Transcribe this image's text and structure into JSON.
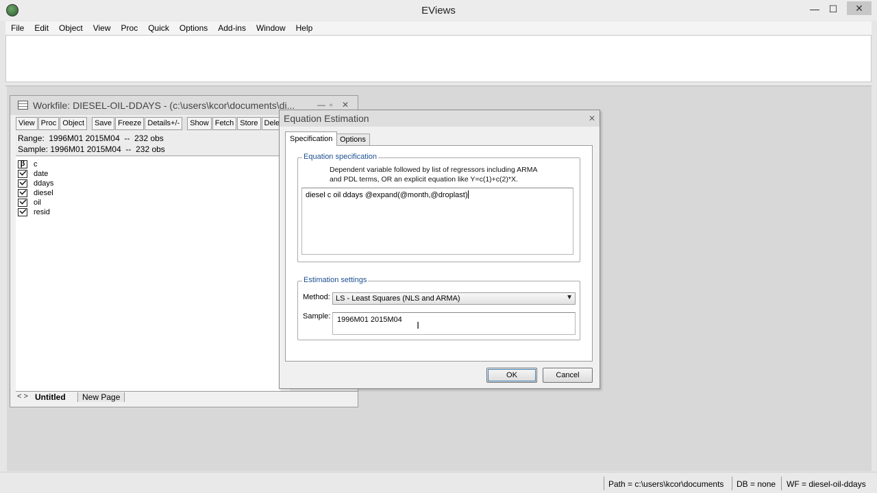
{
  "window": {
    "title": "EViews",
    "minimize": "—",
    "maximize": "☐",
    "close": "✕"
  },
  "menu": [
    "File",
    "Edit",
    "Object",
    "View",
    "Proc",
    "Quick",
    "Options",
    "Add-ins",
    "Window",
    "Help"
  ],
  "workfile": {
    "title": "Workfile: DIESEL-OIL-DDAYS - (c:\\users\\kcor\\documents\\di...",
    "toolbar": [
      "View",
      "Proc",
      "Object",
      "Save",
      "Freeze",
      "Details+/-",
      "Show",
      "Fetch",
      "Store",
      "Delete"
    ],
    "range": "Range:  1996M01 2015M04  --  232 obs",
    "sample": "Sample: 1996M01 2015M04  --  232 obs",
    "objects": [
      {
        "name": "c",
        "icon": "coef-icon"
      },
      {
        "name": "date",
        "icon": "series-icon"
      },
      {
        "name": "ddays",
        "icon": "series-icon"
      },
      {
        "name": "diesel",
        "icon": "series-icon"
      },
      {
        "name": "oil",
        "icon": "series-icon"
      },
      {
        "name": "resid",
        "icon": "series-icon"
      }
    ],
    "tabs": {
      "arrows": "< >",
      "active": "Untitled",
      "new_page": "New Page"
    }
  },
  "dialog": {
    "title": "Equation Estimation",
    "close": "✕",
    "tabs": [
      "Specification",
      "Options"
    ],
    "equation_spec": {
      "legend": "Equation specification",
      "help_line1": "Dependent variable followed by list of regressors including ARMA",
      "help_line2": "and PDL terms, OR an explicit equation like Y=c(1)+c(2)*X.",
      "value": "diesel c oil ddays @expand(@month,@droplast)"
    },
    "estimation": {
      "legend": "Estimation settings",
      "method_label": "Method:",
      "method_value": "LS  - Least Squares (NLS and ARMA)",
      "sample_label": "Sample:",
      "sample_value": "1996M01 2015M04"
    },
    "ok": "OK",
    "cancel": "Cancel"
  },
  "status": {
    "path": "Path = c:\\users\\kcor\\documents",
    "db": "DB = none",
    "wf": "WF = diesel-oil-ddays"
  }
}
